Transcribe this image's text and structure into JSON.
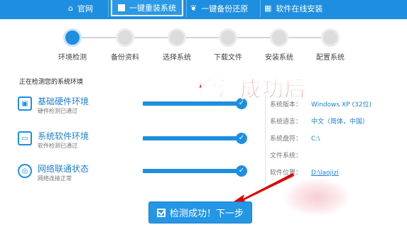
{
  "topbar": {
    "items": [
      {
        "label": "官网",
        "icon": "home-icon"
      },
      {
        "label": "一键重装系统",
        "icon": "windows-icon",
        "active": true
      },
      {
        "label": "一键备份还原",
        "icon": "twitter-bird-icon"
      },
      {
        "label": "软件在线安装",
        "icon": "grid-icon"
      }
    ]
  },
  "steps": [
    {
      "label": "环境检测",
      "active": true
    },
    {
      "label": "备份资料"
    },
    {
      "label": "选择系统"
    },
    {
      "label": "下载文件"
    },
    {
      "label": "安装系统"
    },
    {
      "label": "配置系统"
    }
  ],
  "section_title": "正在检测您的系统环境",
  "checks": [
    {
      "title": "基础硬件环境",
      "sub": "硬件检测已通过",
      "icon": "hardware-icon"
    },
    {
      "title": "系统软件环境",
      "sub": "软件检测已通过",
      "icon": "monitor-icon"
    },
    {
      "title": "网络联通状态",
      "sub": "网络连接正常",
      "icon": "globe-icon"
    }
  ],
  "overlay_text": "检测成功后",
  "info": [
    {
      "key": "系统版本：",
      "value": "Windows XP (32位)"
    },
    {
      "key": "系统语言：",
      "value": "中文（简体，中国）"
    },
    {
      "key": "系统盘符：",
      "value": "C:\\"
    },
    {
      "key": "文件系统：",
      "value": ""
    },
    {
      "key": "软件位置：",
      "value": "D:\\laojizi"
    }
  ],
  "next_button": "检测成功！下一步",
  "colors": {
    "accent": "#1e8fe0",
    "overlay_red": "#e00000"
  }
}
